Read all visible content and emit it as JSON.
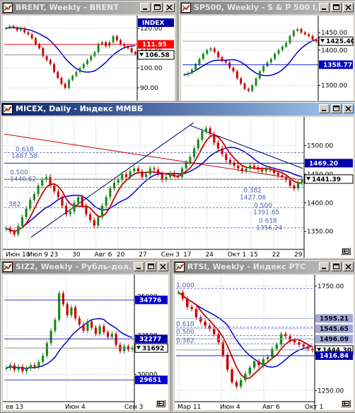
{
  "colors": {
    "up": "#1a8a1a",
    "down": "#cc0000",
    "grid": "#b8b8d8",
    "ma_red": "#cc0000",
    "ma_blue": "#0000cc",
    "level_box": "#0000cc",
    "title_active": "#0a246a",
    "title_inactive": "#808080"
  },
  "icons": {
    "window": "chart-window-icon",
    "minimize": "minimize-icon",
    "maximize": "maximize-icon",
    "close": "close-icon",
    "date_scale": "date-scale-icon"
  },
  "windows": [
    {
      "id": "brent",
      "title": "BRENT, Weekly - BRENT",
      "active": false,
      "text_labels": [],
      "price_labels": [
        {
          "text": "INDEX",
          "style": "navy"
        },
        {
          "text": "111.95",
          "style": "red"
        },
        {
          "text": "106.58",
          "style": "black",
          "arrow": true
        }
      ],
      "axis_labels": [
        "120.00",
        "110.00",
        "100.00",
        "90.00"
      ],
      "date_labels": [],
      "chart_data": {
        "type": "candlestick",
        "y_range": [
          85,
          125
        ],
        "axis_ticks": [
          120,
          110,
          100,
          90
        ],
        "price_levels": [
          {
            "label": "111.95",
            "value": 111.95,
            "color": "#ff0000"
          },
          {
            "label": "106.58",
            "value": 106.58,
            "color": "#ffffff"
          }
        ],
        "series": [
          {
            "name": "close",
            "values": [
              120,
              121,
              120.5,
              119,
              120,
              118,
              117,
              115,
              112,
              110,
              106,
              104,
              102,
              98,
              95,
              92,
              90,
              94,
              96,
              98,
              100,
              102,
              104,
              106,
              108,
              112,
              113,
              111,
              113,
              116,
              114,
              112,
              111,
              110,
              108,
              107
            ]
          }
        ]
      }
    },
    {
      "id": "sp500",
      "title": "SP500, Weekly - S & P 500 I...",
      "active": false,
      "text_labels": [],
      "price_labels": [
        {
          "text": "1425.40",
          "style": "black",
          "arrow": true
        },
        {
          "text": "1358.77",
          "style": "blue"
        }
      ],
      "axis_labels": [
        "1450.00",
        "1400.00",
        "1300.00"
      ],
      "date_labels": [],
      "chart_data": {
        "type": "candlestick",
        "y_range": [
          1265,
          1490
        ],
        "axis_ticks": [
          1450,
          1400,
          1300
        ],
        "price_levels": [
          {
            "label": "1425.40",
            "value": 1425.4,
            "color": "#ffffff"
          },
          {
            "label": "1358.77",
            "value": 1358.77,
            "color": "#0000cc"
          }
        ],
        "series": [
          {
            "name": "close",
            "values": [
              1330,
              1335,
              1345,
              1360,
              1375,
              1390,
              1400,
              1405,
              1395,
              1380,
              1370,
              1365,
              1350,
              1340,
              1320,
              1305,
              1290,
              1285,
              1300,
              1320,
              1340,
              1355,
              1365,
              1375,
              1390,
              1400,
              1410,
              1420,
              1440,
              1455,
              1460,
              1450,
              1445,
              1440,
              1430,
              1425
            ]
          }
        ]
      }
    },
    {
      "id": "micex",
      "title": "MICEX, Daily - Индекс ММВБ",
      "active": true,
      "text_labels": [
        "0.618",
        "1487.58",
        "0.500",
        "1440.62",
        "0.382",
        "1427.06",
        "0.500",
        "1391.65",
        "0.618",
        "1356.24",
        "382"
      ],
      "price_labels": [
        {
          "text": "1469.20",
          "style": "navy"
        },
        {
          "text": "1441.39",
          "style": "black",
          "arrow": true
        }
      ],
      "axis_labels": [
        "1500.00",
        "1450.00",
        "1400.00",
        "1350.00"
      ],
      "date_labels": [
        "Июн 18",
        "Июл 9",
        "23",
        "30",
        "Авг 6",
        "20",
        "27",
        "Сен 3",
        "17",
        "24",
        "Окт 1",
        "15",
        "22",
        "29"
      ],
      "chart_data": {
        "type": "candlestick",
        "y_range": [
          1320,
          1545
        ],
        "axis_ticks": [
          1500,
          1450,
          1400,
          1350
        ],
        "price_levels": [
          {
            "label": "1469.20",
            "value": 1469.2,
            "color": "#0000cc"
          },
          {
            "label": "1441.39",
            "value": 1441.39,
            "color": "#ffffff"
          }
        ],
        "fibonacci": [
          {
            "ratio": "0.618",
            "value": 1487.58
          },
          {
            "ratio": "0.500",
            "value": 1440.62
          },
          {
            "ratio": "0.382",
            "value": 1427.06
          },
          {
            "ratio": "0.500",
            "value": 1391.65
          },
          {
            "ratio": "0.618",
            "value": 1356.24
          }
        ],
        "series": [
          {
            "name": "close",
            "values": [
              1355,
              1350,
              1345,
              1360,
              1375,
              1390,
              1405,
              1415,
              1430,
              1440,
              1445,
              1430,
              1420,
              1410,
              1395,
              1380,
              1385,
              1400,
              1410,
              1395,
              1380,
              1370,
              1360,
              1375,
              1395,
              1410,
              1425,
              1435,
              1440,
              1450,
              1445,
              1455,
              1460,
              1455,
              1445,
              1450,
              1460,
              1458,
              1450,
              1440,
              1445,
              1452,
              1448,
              1445,
              1460,
              1470,
              1480,
              1495,
              1510,
              1525,
              1530,
              1520,
              1505,
              1495,
              1485,
              1475,
              1470,
              1465,
              1460,
              1455,
              1460,
              1465,
              1462,
              1458,
              1455,
              1460,
              1458,
              1452,
              1448,
              1445,
              1440,
              1430,
              1425,
              1435,
              1441
            ]
          }
        ]
      }
    },
    {
      "id": "siz2",
      "title": "SIZ2, Weekly - Рубль-дол...",
      "active": false,
      "text_labels": [],
      "price_labels": [
        {
          "text": "34776",
          "style": "blue"
        },
        {
          "text": "32277",
          "style": "navy"
        },
        {
          "text": "31692",
          "style": "black",
          "arrow": true
        },
        {
          "text": "29651",
          "style": "blue"
        }
      ],
      "axis_labels": [
        "35000",
        "32500",
        "30000"
      ],
      "date_labels": [
        "ев 13",
        "Июн 4",
        "Сен 3"
      ],
      "chart_data": {
        "type": "candlestick",
        "y_range": [
          28300,
          36200
        ],
        "axis_ticks": [
          35000,
          32500,
          30000
        ],
        "price_levels": [
          {
            "label": "34776",
            "value": 34776,
            "color": "#0000cc"
          },
          {
            "label": "32277",
            "value": 32277,
            "color": "#0000cc"
          },
          {
            "label": "31692",
            "value": 31692,
            "color": "#ffffff"
          },
          {
            "label": "29651",
            "value": 29651,
            "color": "#0000cc"
          }
        ],
        "series": [
          {
            "name": "close",
            "values": [
              30400,
              30600,
              30300,
              30500,
              30200,
              30400,
              30600,
              30500,
              30800,
              31200,
              32000,
              32800,
              33500,
              35200,
              34500,
              33800,
              34300,
              33600,
              33200,
              32800,
              33400,
              33000,
              32600,
              33100,
              32700,
              32400,
              32600,
              31900,
              31500,
              31800,
              31600,
              31700
            ]
          }
        ]
      }
    },
    {
      "id": "rtsi",
      "title": "RTSI, Weekly - Индекс РТС",
      "active": false,
      "text_labels": [
        "1.000",
        "0.618",
        "0.500",
        "0.382"
      ],
      "price_labels": [
        {
          "text": "1595.21",
          "style": "steel"
        },
        {
          "text": "1545.65",
          "style": "steel"
        },
        {
          "text": "1496.09",
          "style": "steel"
        },
        {
          "text": "1444.30",
          "style": "black",
          "arrow": true
        },
        {
          "text": "1416.84",
          "style": "navy"
        }
      ],
      "axis_labels": [
        "1750.00",
        "1500.00",
        "1250.00"
      ],
      "date_labels": [
        "Мар 11",
        "Июн 4",
        "Авг 6",
        "Окт 1"
      ],
      "chart_data": {
        "type": "candlestick",
        "y_range": [
          1200,
          1790
        ],
        "axis_ticks": [
          1750,
          1500,
          1250
        ],
        "price_levels": [
          {
            "label": "1595.21",
            "value": 1595.21,
            "color": "#a0a8d8"
          },
          {
            "label": "1545.65",
            "value": 1545.65,
            "color": "#a0a8d8"
          },
          {
            "label": "1496.09",
            "value": 1496.09,
            "color": "#a0a8d8"
          },
          {
            "label": "1444.30",
            "value": 1444.3,
            "color": "#ffffff"
          },
          {
            "label": "1416.84",
            "value": 1416.84,
            "color": "#0000cc"
          }
        ],
        "series": [
          {
            "name": "close",
            "values": [
              1720,
              1690,
              1650,
              1640,
              1600,
              1580,
              1560,
              1545,
              1520,
              1480,
              1420,
              1350,
              1290,
              1270,
              1300,
              1330,
              1360,
              1390,
              1370,
              1400,
              1410,
              1450,
              1470,
              1520,
              1510,
              1490,
              1480,
              1470,
              1460,
              1450,
              1444
            ]
          }
        ]
      }
    }
  ]
}
